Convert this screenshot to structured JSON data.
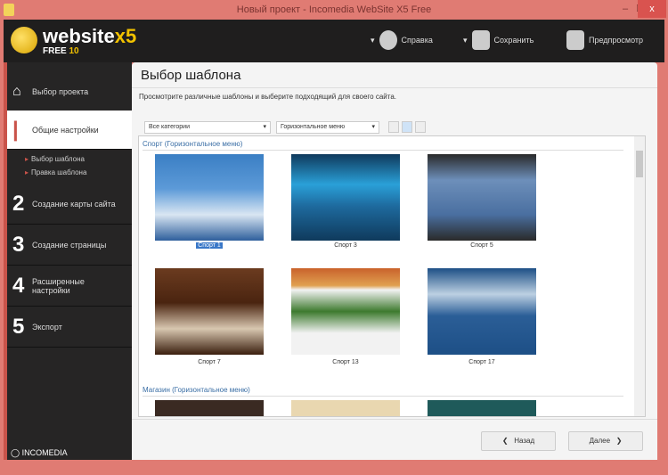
{
  "window": {
    "title": "Новый проект - Incomedia WebSite X5 Free",
    "minimize": "–",
    "maximize": "☐",
    "close": "x"
  },
  "logo": {
    "text": "website",
    "x5": "x5",
    "free": "FREE",
    "version": "10"
  },
  "toolbar": {
    "help": "Справка",
    "save": "Сохранить",
    "preview": "Предпросмотр"
  },
  "sidebar": {
    "items": [
      {
        "num": "",
        "label": "Выбор проекта"
      },
      {
        "num": "1",
        "label": "Общие настройки"
      },
      {
        "num": "2",
        "label": "Создание карты сайта"
      },
      {
        "num": "3",
        "label": "Создание страницы"
      },
      {
        "num": "4",
        "label": "Расширенные настройки"
      },
      {
        "num": "5",
        "label": "Экспорт"
      }
    ],
    "subitems": [
      "Выбор шаблона",
      "Правка шаблона"
    ],
    "brand": "INCOMEDIA"
  },
  "main": {
    "title": "Выбор шаблона",
    "description": "Просмотрите различные шаблоны и выберите подходящий для своего сайта.",
    "category_select": "Все категории",
    "menu_select": "Горизонтальное меню",
    "sections": [
      {
        "name": "Спорт (Горизонтальное меню)",
        "templates": [
          "Спорт 1",
          "Спорт 3",
          "Спорт 5",
          "Спорт 7",
          "Спорт 13",
          "Спорт 17"
        ]
      },
      {
        "name": "Магазин (Горизонтальное меню)"
      }
    ],
    "back": "Назад",
    "next": "Далее"
  }
}
